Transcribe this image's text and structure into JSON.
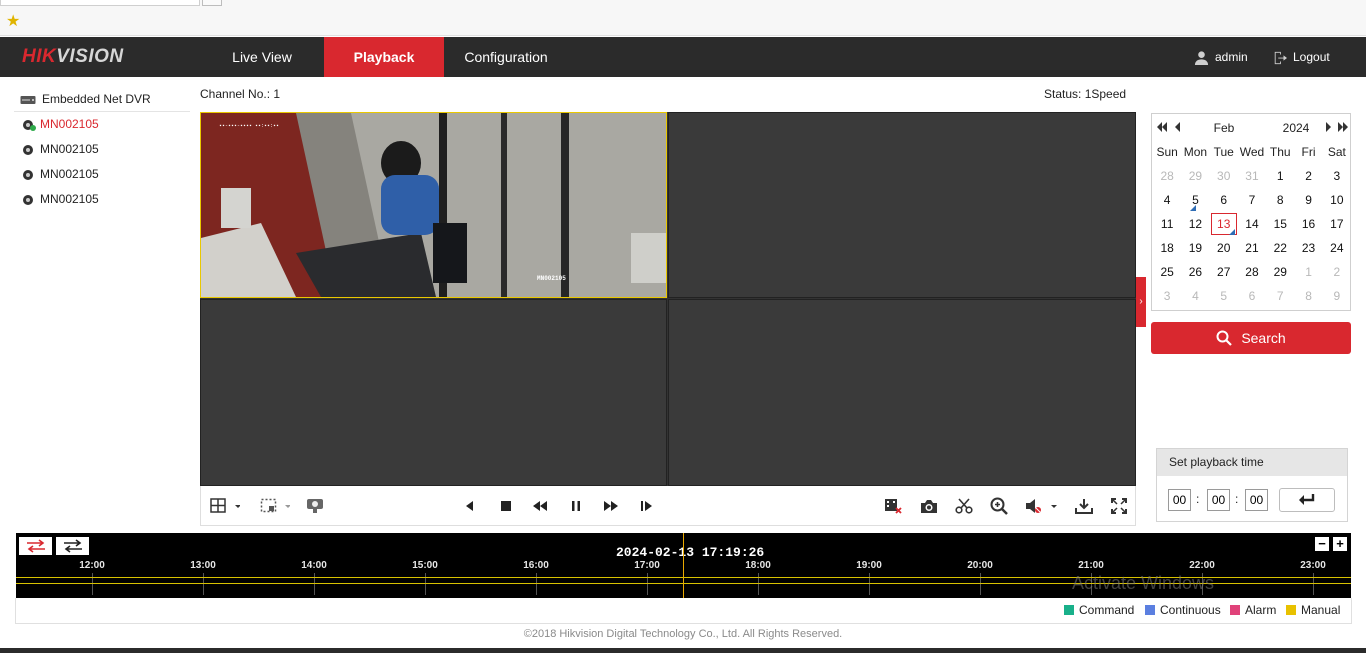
{
  "brand": {
    "logo_red": "HIK",
    "logo_gray": "VISION"
  },
  "nav": {
    "live_view": "Live View",
    "playback": "Playback",
    "configuration": "Configuration"
  },
  "user": {
    "name": "admin",
    "logout": "Logout"
  },
  "tree": {
    "root": "Embedded Net DVR",
    "cameras": [
      "MN002105",
      "MN002105",
      "MN002105",
      "MN002105"
    ],
    "selected_index": 0
  },
  "info": {
    "channel": "Channel No.: 1",
    "status": "Status: 1Speed"
  },
  "video": {
    "cam_label": "MN002105"
  },
  "calendar": {
    "month": "Feb",
    "year": "2024",
    "weekdays": [
      "Sun",
      "Mon",
      "Tue",
      "Wed",
      "Thu",
      "Fri",
      "Sat"
    ],
    "weeks": [
      [
        [
          "28",
          "other"
        ],
        [
          "29",
          "other"
        ],
        [
          "30",
          "other"
        ],
        [
          "31",
          "other"
        ],
        [
          "1",
          ""
        ],
        [
          "2",
          ""
        ],
        [
          "3",
          ""
        ]
      ],
      [
        [
          "4",
          ""
        ],
        [
          "5",
          "rec"
        ],
        [
          "6",
          ""
        ],
        [
          "7",
          ""
        ],
        [
          "8",
          ""
        ],
        [
          "9",
          ""
        ],
        [
          "10",
          ""
        ]
      ],
      [
        [
          "11",
          ""
        ],
        [
          "12",
          ""
        ],
        [
          "13",
          "today"
        ],
        [
          "14",
          ""
        ],
        [
          "15",
          ""
        ],
        [
          "16",
          ""
        ],
        [
          "17",
          ""
        ]
      ],
      [
        [
          "18",
          ""
        ],
        [
          "19",
          ""
        ],
        [
          "20",
          ""
        ],
        [
          "21",
          ""
        ],
        [
          "22",
          ""
        ],
        [
          "23",
          ""
        ],
        [
          "24",
          ""
        ]
      ],
      [
        [
          "25",
          ""
        ],
        [
          "26",
          ""
        ],
        [
          "27",
          ""
        ],
        [
          "28",
          ""
        ],
        [
          "29",
          ""
        ],
        [
          "1",
          "other"
        ],
        [
          "2",
          "other"
        ]
      ],
      [
        [
          "3",
          "other"
        ],
        [
          "4",
          "other"
        ],
        [
          "5",
          "other"
        ],
        [
          "6",
          "other"
        ],
        [
          "7",
          "other"
        ],
        [
          "8",
          "other"
        ],
        [
          "9",
          "other"
        ]
      ]
    ]
  },
  "search": {
    "label": "Search"
  },
  "playback_time": {
    "title": "Set playback time",
    "hh": "00",
    "mm": "00",
    "ss": "00",
    "sep": ":"
  },
  "timeline": {
    "current_time": "2024-02-13 17:19:26",
    "ticks": [
      "12:00",
      "13:00",
      "14:00",
      "15:00",
      "16:00",
      "17:00",
      "18:00",
      "19:00",
      "20:00",
      "21:00",
      "22:00",
      "23:00"
    ]
  },
  "legend": [
    {
      "label": "Command",
      "color": "#19b08a"
    },
    {
      "label": "Continuous",
      "color": "#5b7fe0"
    },
    {
      "label": "Alarm",
      "color": "#e0427a"
    },
    {
      "label": "Manual",
      "color": "#e8c100"
    }
  ],
  "watermark": {
    "line1": "Activate Windows"
  },
  "footer": "©2018 Hikvision Digital Technology Co., Ltd. All Rights Reserved.",
  "colors": {
    "accent": "#d9282f",
    "header": "#2b2b2b",
    "selection": "#e9c800"
  }
}
